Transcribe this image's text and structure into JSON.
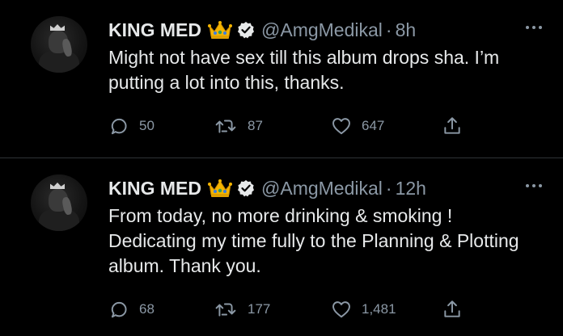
{
  "tweets": [
    {
      "author_name": "KING MED",
      "handle": "@AmgMedikal",
      "separator": "·",
      "time": "8h",
      "text": "Might not have sex till this album drops sha. I’m putting a lot into this, thanks.",
      "replies": "50",
      "retweets": "87",
      "likes": "647"
    },
    {
      "author_name": "KING MED",
      "handle": "@AmgMedikal",
      "separator": "·",
      "time": "12h",
      "text": "From today, no more drinking & smoking ! Dedicating my time fully to the Planning & Plotting album. Thank you.",
      "replies": "68",
      "retweets": "177",
      "likes": "1,481"
    }
  ],
  "icons": {
    "crown": "crown-emoji",
    "verified": "verified-badge-icon",
    "more": "more-horizontal-icon",
    "reply": "reply-icon",
    "retweet": "retweet-icon",
    "like": "heart-icon",
    "share": "share-icon"
  },
  "colors": {
    "background": "#000000",
    "text": "#e7e9ea",
    "muted": "#8b98a5",
    "divider": "#2f3336",
    "crown_gold": "#f4b400",
    "crown_gem_green": "#2e9e5b",
    "crown_gem_blue": "#3b7de0"
  }
}
